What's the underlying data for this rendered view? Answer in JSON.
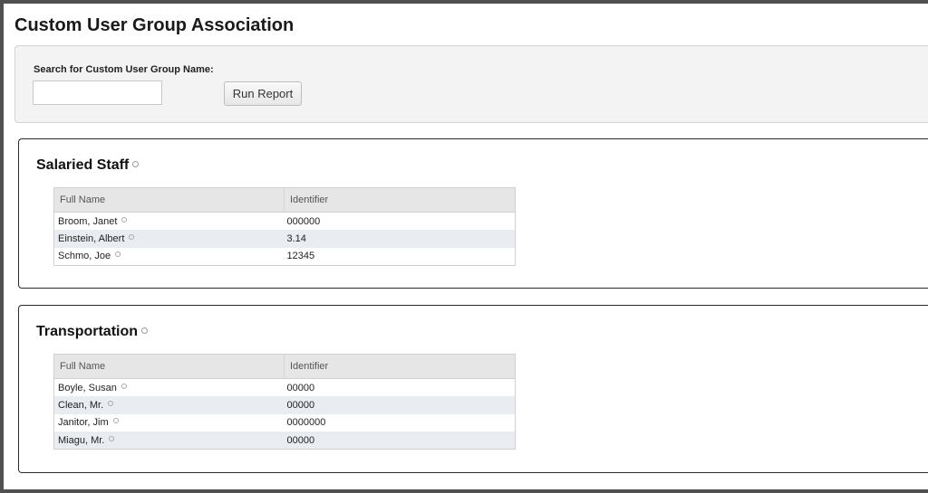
{
  "page": {
    "title": "Custom User Group Association"
  },
  "search": {
    "label": "Search for Custom User Group Name:",
    "value": "",
    "button_label": "Run Report"
  },
  "groups": [
    {
      "name": "Salaried Staff",
      "columns": [
        "Full Name",
        "Identifier"
      ],
      "rows": [
        {
          "full_name": "Broom, Janet",
          "identifier": "000000"
        },
        {
          "full_name": "Einstein, Albert",
          "identifier": "3.14"
        },
        {
          "full_name": "Schmo, Joe",
          "identifier": "12345"
        }
      ]
    },
    {
      "name": "Transportation",
      "columns": [
        "Full Name",
        "Identifier"
      ],
      "rows": [
        {
          "full_name": "Boyle, Susan",
          "identifier": "00000"
        },
        {
          "full_name": "Clean, Mr.",
          "identifier": "00000"
        },
        {
          "full_name": "Janitor, Jim",
          "identifier": "0000000"
        },
        {
          "full_name": "Miagu, Mr.",
          "identifier": "00000"
        }
      ]
    }
  ],
  "icons": {
    "info": "info-circle-icon"
  },
  "colors": {
    "frame": "#505050",
    "panel_bg": "#f3f3f3",
    "row_alt": "#e9edf1",
    "header_bg": "#e6e6e6"
  }
}
